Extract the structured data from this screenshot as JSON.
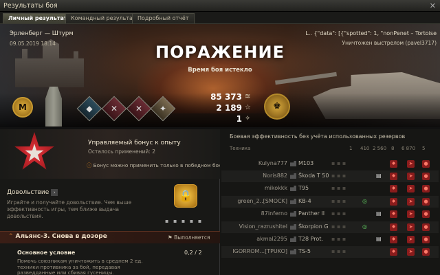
{
  "window": {
    "title": "Результаты боя",
    "close_glyph": "✕"
  },
  "tabs": [
    {
      "label": "Личный результат"
    },
    {
      "label": "Командный результат"
    },
    {
      "label": "Подробный отчёт"
    }
  ],
  "header": {
    "map_mode": "Эрленберг — Штурм",
    "date": "09.05.2019 18:14",
    "result": "ПОРАЖЕНИЕ",
    "reason": "Время боя истекло",
    "player_line": "L.. {\"data\": [{\"spotted\": 1, \"nonPenet – Tortoise",
    "killed_by": "Уничтожен выстрелом (pavel3717)"
  },
  "rewards": {
    "mastery_badge": "M",
    "credits": "85 373",
    "xp": "2 189",
    "free_xp": "1",
    "credits_icon": "credits-icon",
    "xp_icon": "star-icon",
    "free_xp_icon": "free-xp-icon"
  },
  "medals": [
    "shield-icon",
    "crossed-swords-icon",
    "crossed-swords-icon",
    "diamond-icon"
  ],
  "bonus": {
    "title": "Управляемый бонус к опыту",
    "uses": "Осталось применений: 2",
    "note": "Бонус можно применить только в победном бою"
  },
  "content": {
    "title": "Довольствие",
    "desc": "Играйте и получайте довольствие. Чем выше эффективность игры, тем ближе выдача довольствия."
  },
  "mission": {
    "title": "Альянс-3. Снова в дозоре",
    "state": "Выполняется",
    "condition_title": "Основное условие",
    "condition_progress": "0,2 / 2",
    "condition_desc": "Помочь союзникам уничтожить в среднем 2 ед. техники противника за бой, передавая разведданные или сбивая гусеницы."
  },
  "team": {
    "title": "Боевая эффективность без учёта использованных резервов",
    "headers": {
      "vehicle": "Техника",
      "c1": "1",
      "c2": "410",
      "c3": "2 560",
      "c4": "8",
      "c5": "6 870",
      "c6": "5"
    },
    "rows": [
      {
        "player": "Kulyna777",
        "tank": "M103"
      },
      {
        "player": "Noris882",
        "tank": "Škoda T 50"
      },
      {
        "player": "mikokkk",
        "tank": "T95"
      },
      {
        "player": "green_2..[SMOCK]",
        "tank": "KB-4"
      },
      {
        "player": "87inferno",
        "tank": "Panther II"
      },
      {
        "player": "Vision_razrushitel",
        "tank": "Škorpion G"
      },
      {
        "player": "akmal2295",
        "tank": "T28 Prot."
      },
      {
        "player": "IGORROM...[TPUKO]",
        "tank": "TS-5"
      }
    ]
  },
  "colors": {
    "accent": "#e08a20",
    "defeat_red": "#8a1c1c",
    "gold": "#d7a93c"
  }
}
